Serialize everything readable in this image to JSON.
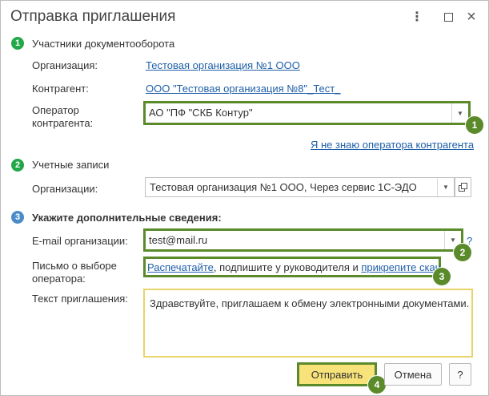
{
  "window": {
    "title": "Отправка приглашения"
  },
  "titlebar": {
    "more": "⋮",
    "close": "×"
  },
  "steps": [
    {
      "num": "1",
      "title": "Участники документооборота"
    },
    {
      "num": "2",
      "title": "Учетные записи"
    },
    {
      "num": "3",
      "title": "Укажите дополнительные сведения:"
    }
  ],
  "participants": {
    "org_label": "Организация:",
    "org_value": "Тестовая организация №1 ООО",
    "counterparty_label": "Контрагент:",
    "counterparty_value": "ООО \"Тестовая организация №8\"_Тест_",
    "operator_label": "Оператор контрагента:",
    "operator_value": "АО \"ПФ \"СКБ Контур\"",
    "unknown_operator_link": "Я не знаю оператора контрагента"
  },
  "accounts": {
    "orgs_label": "Организации:",
    "orgs_value": "Тестовая организация №1 ООО, Через сервис 1С-ЭДО"
  },
  "additional": {
    "email_label": "E-mail организации:",
    "email_value": "test@mail.ru",
    "help": "?",
    "letter_label": "Письмо о выборе оператора:",
    "print_link": "Распечатайте",
    "letter_middle": ", подпишите у руководителя и ",
    "attach_link": "прикрепите скан",
    "invite_label": "Текст приглашения:",
    "invite_text": "Здравствуйте, приглашаем к обмену электронными документами."
  },
  "buttons": {
    "send": "Отправить",
    "cancel": "Отмена",
    "help": "?"
  },
  "markers": [
    "1",
    "2",
    "3",
    "4"
  ],
  "colors": {
    "step_green": "#22a849",
    "step_blue": "#4a8bc8",
    "highlight": "#5a8a2a",
    "link": "#1f5fa8",
    "primary_button": "#f8e37a"
  }
}
